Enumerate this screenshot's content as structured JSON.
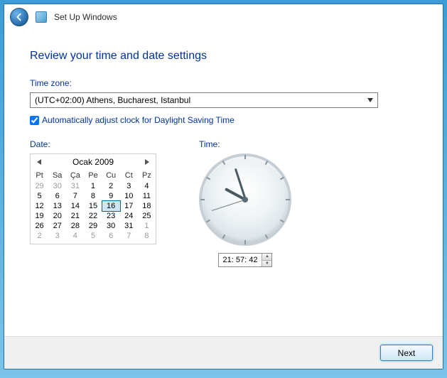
{
  "header": {
    "title": "Set Up Windows"
  },
  "page": {
    "heading": "Review your time and date settings",
    "timezone_label": "Time zone:",
    "timezone_value": "(UTC+02:00) Athens, Bucharest, Istanbul",
    "dst_label": "Automatically adjust clock for Daylight Saving Time",
    "dst_checked": true,
    "date_label": "Date:",
    "time_label": "Time:"
  },
  "calendar": {
    "month_title": "Ocak 2009",
    "day_headers": [
      "Pt",
      "Sa",
      "Ça",
      "Pe",
      "Cu",
      "Ct",
      "Pz"
    ],
    "weeks": [
      [
        {
          "n": 29,
          "muted": true
        },
        {
          "n": 30,
          "muted": true
        },
        {
          "n": 31,
          "muted": true
        },
        {
          "n": 1
        },
        {
          "n": 2
        },
        {
          "n": 3
        },
        {
          "n": 4
        }
      ],
      [
        {
          "n": 5
        },
        {
          "n": 6
        },
        {
          "n": 7
        },
        {
          "n": 8
        },
        {
          "n": 9
        },
        {
          "n": 10
        },
        {
          "n": 11
        }
      ],
      [
        {
          "n": 12
        },
        {
          "n": 13
        },
        {
          "n": 14
        },
        {
          "n": 15
        },
        {
          "n": 16,
          "selected": true
        },
        {
          "n": 17
        },
        {
          "n": 18
        }
      ],
      [
        {
          "n": 19
        },
        {
          "n": 20
        },
        {
          "n": 21
        },
        {
          "n": 22
        },
        {
          "n": 23
        },
        {
          "n": 24
        },
        {
          "n": 25
        }
      ],
      [
        {
          "n": 26
        },
        {
          "n": 27
        },
        {
          "n": 28
        },
        {
          "n": 29
        },
        {
          "n": 30
        },
        {
          "n": 31
        },
        {
          "n": 1,
          "muted": true
        }
      ],
      [
        {
          "n": 2,
          "muted": true
        },
        {
          "n": 3,
          "muted": true
        },
        {
          "n": 4,
          "muted": true
        },
        {
          "n": 5,
          "muted": true
        },
        {
          "n": 6,
          "muted": true
        },
        {
          "n": 7,
          "muted": true
        },
        {
          "n": 8,
          "muted": true
        }
      ]
    ]
  },
  "clock": {
    "display": "21: 57: 42",
    "hours": 21,
    "minutes": 57,
    "seconds": 42
  },
  "footer": {
    "next_label": "Next"
  }
}
